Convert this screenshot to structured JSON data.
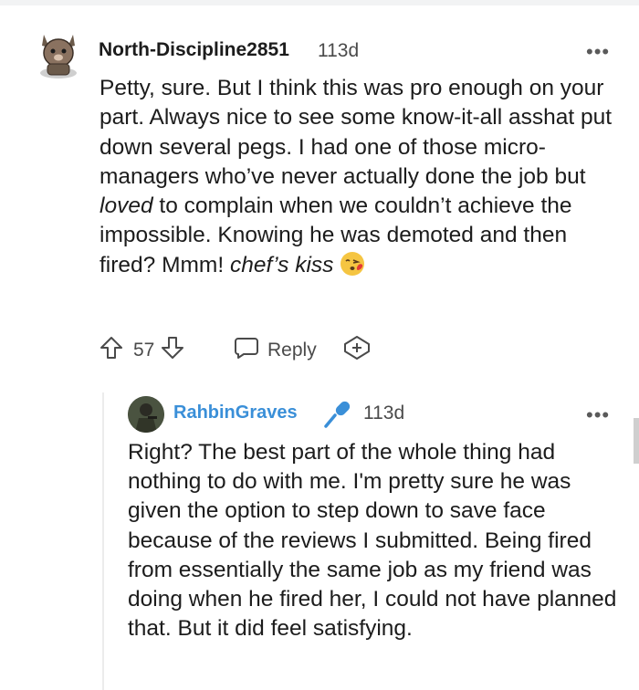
{
  "comment": {
    "username": "North-Discipline2851",
    "age": "113d",
    "text_parts": {
      "p1": "Petty, sure. But I think this was pro enough on your part. Always nice to see some know-it-all asshat put down several pegs. I had one of those micro-managers who’ve never actually done the job but ",
      "p2_italic": "loved",
      "p3": " to complain when we couldn’t achieve the impossible. Knowing he was demoted and then fired? Mmm! ",
      "p4_italic": "chef’s kiss"
    },
    "emoji": "kissing-face-emoji",
    "votes": "57",
    "reply_label": "Reply"
  },
  "reply": {
    "username": "RahbinGraves",
    "age": "113d",
    "text": "Right? The best part of the whole thing had nothing to do with me. I'm pretty sure he was given the option to step down to save face because of the reviews I submitted. Being fired from essentially the same job as my friend was doing when he fired her, I could not have planned that. But it did feel satisfying."
  },
  "colors": {
    "username_blue": "#3a8fd8",
    "text": "#1c1c1c",
    "muted": "#4a4a4a"
  },
  "icons": [
    "more-icon",
    "upvote-icon",
    "downvote-icon",
    "reply-icon",
    "award-icon",
    "microphone-icon"
  ]
}
